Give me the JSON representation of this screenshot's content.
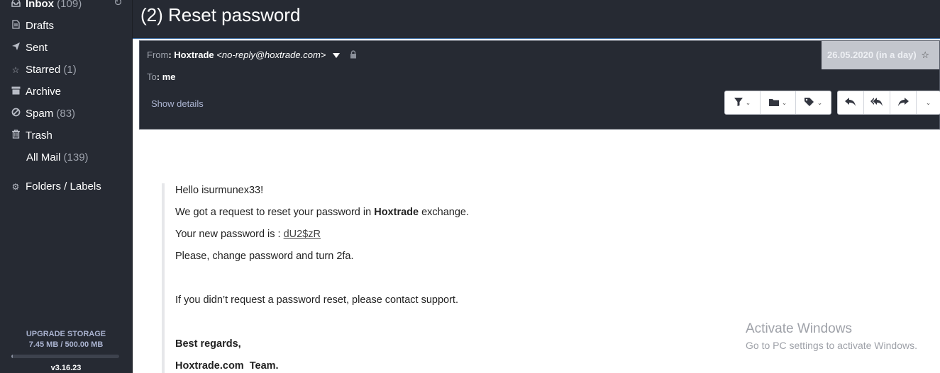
{
  "sidebar": {
    "inbox": {
      "label": "Inbox",
      "count": "(109)"
    },
    "drafts": {
      "label": "Drafts"
    },
    "sent": {
      "label": "Sent"
    },
    "starred": {
      "label": "Starred",
      "count": "(1)"
    },
    "archive": {
      "label": "Archive"
    },
    "spam": {
      "label": "Spam",
      "count": "(83)"
    },
    "trash": {
      "label": "Trash"
    },
    "allmail": {
      "label": "All Mail",
      "count": "(139)"
    },
    "folders": {
      "label": "Folders / Labels"
    },
    "storage": {
      "title": "UPGRADE STORAGE",
      "usage": "7.45 MB / 500.00 MB",
      "used_fraction": 0.0149
    },
    "version": "v3.16.23"
  },
  "message": {
    "subject": "(2) Reset password",
    "from_label": "From",
    "from_name": "Hoxtrade",
    "from_email": "<no-reply@hoxtrade.com>",
    "to_label": "To",
    "to_value": "me",
    "date": "26.05.2020 (in a day)",
    "show_details": "Show details"
  },
  "body": {
    "greeting": "Hello isurmunex33!",
    "line1_pre": "We got a request to reset your password in ",
    "line1_bold": "Hoxtrade",
    "line1_post": " exchange.",
    "line2_pre": "Your new password is : ",
    "password": "dU2$zR",
    "line3": "Please, change password and turn 2fa.",
    "line4": "If you didn’t request a password reset, please contact support.",
    "regards": "Best regards,",
    "team": "Hoxtrade.com  Team."
  },
  "watermark": {
    "title": "Activate Windows",
    "subtitle": "Go to PC settings to activate Windows."
  },
  "colors": {
    "sidebar_bg": "#262a33",
    "accent_link": "#aab3d0"
  }
}
